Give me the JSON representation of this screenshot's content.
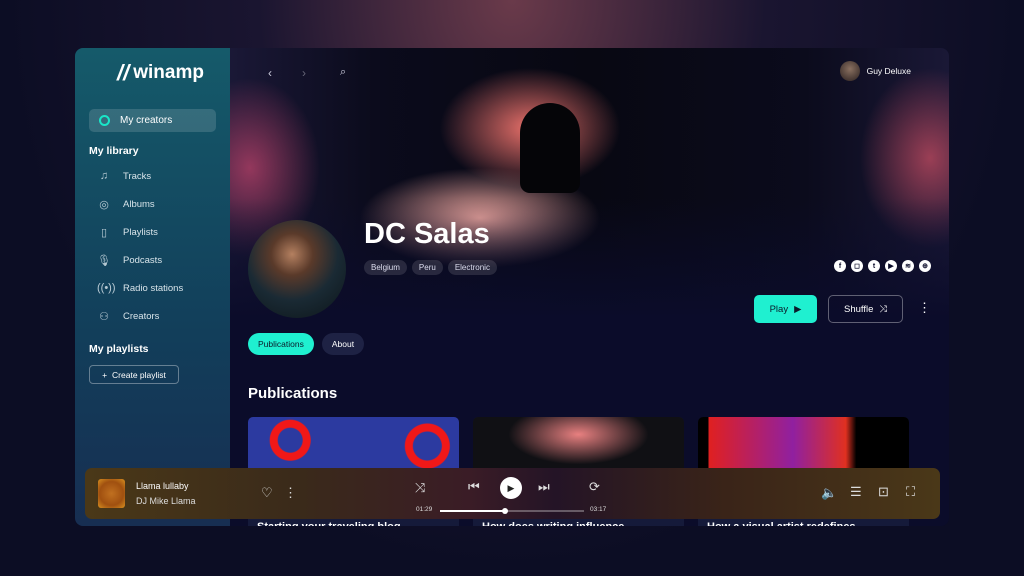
{
  "app": {
    "logo": "winamp"
  },
  "sidebar": {
    "active": "My creators",
    "library_heading": "My library",
    "items": [
      {
        "label": "Tracks",
        "icon": "music-note-icon"
      },
      {
        "label": "Albums",
        "icon": "disc-icon"
      },
      {
        "label": "Playlists",
        "icon": "playlist-icon"
      },
      {
        "label": "Podcasts",
        "icon": "microphone-icon"
      },
      {
        "label": "Radio stations",
        "icon": "radio-icon"
      },
      {
        "label": "Creators",
        "icon": "person-icon"
      }
    ],
    "playlists_heading": "My playlists",
    "create_playlist": "Create playlist"
  },
  "header": {
    "user": "Guy Deluxe"
  },
  "artist": {
    "name": "DC Salas",
    "tags": [
      "Belgium",
      "Peru",
      "Electronic"
    ],
    "social": [
      "facebook",
      "instagram",
      "twitter",
      "youtube",
      "spotify",
      "website"
    ],
    "play": "Play",
    "shuffle": "Shuffle"
  },
  "tabs": [
    {
      "label": "Publications",
      "active": true
    },
    {
      "label": "About",
      "active": false
    }
  ],
  "publications": {
    "heading": "Publications",
    "cards": [
      {
        "title": "Starting your traveling blog"
      },
      {
        "title": "How does writing influence"
      },
      {
        "title": "How a visual artist redefines"
      }
    ]
  },
  "player": {
    "track": "Llama lullaby",
    "artist": "DJ Mike Llama",
    "elapsed": "01:29",
    "duration": "03:17",
    "progress_percent": 45
  },
  "colors": {
    "accent": "#1ff0d0"
  }
}
